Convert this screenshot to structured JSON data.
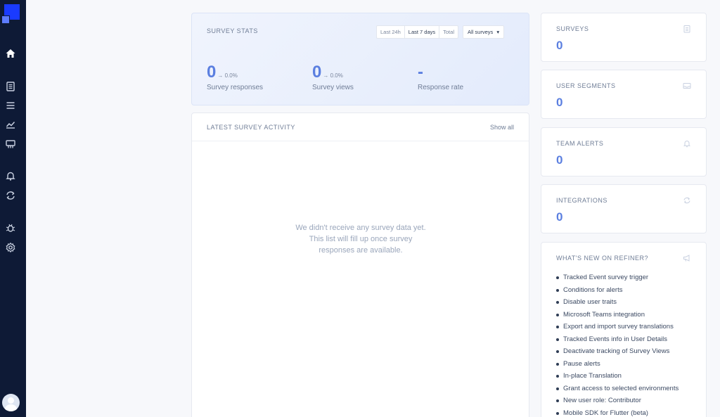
{
  "sidebar": {
    "items": [
      {
        "name": "home-icon"
      },
      {
        "name": "surveys-icon"
      },
      {
        "name": "list-icon"
      },
      {
        "name": "chart-icon"
      },
      {
        "name": "segments-icon"
      },
      {
        "name": "bell-icon"
      },
      {
        "name": "sync-icon"
      },
      {
        "name": "bug-icon"
      },
      {
        "name": "gear-icon"
      }
    ]
  },
  "stats": {
    "title": "SURVEY STATS",
    "filters": [
      "Last 24h",
      "Last 7 days",
      "Total"
    ],
    "active_filter": "Last 7 days",
    "select": "All surveys",
    "responses": {
      "value": "0",
      "change": "→ 0.0%",
      "label": "Survey responses"
    },
    "views": {
      "value": "0",
      "change": "→ 0.0%",
      "label": "Survey views"
    },
    "rate": {
      "value": "-",
      "label": "Response rate"
    }
  },
  "activity": {
    "title": "LATEST SURVEY ACTIVITY",
    "show_all": "Show all",
    "empty_message": "We didn't receive any survey data yet. This list will fill up once survey responses are available."
  },
  "side_cards": {
    "surveys": {
      "title": "SURVEYS",
      "value": "0",
      "icon": "clipboard-icon"
    },
    "segments": {
      "title": "USER SEGMENTS",
      "value": "0",
      "icon": "inbox-icon"
    },
    "alerts": {
      "title": "TEAM ALERTS",
      "value": "0",
      "icon": "bell-icon"
    },
    "integrations": {
      "title": "INTEGRATIONS",
      "value": "0",
      "icon": "sync-icon"
    }
  },
  "news": {
    "title": "WHAT'S NEW ON REFINER?",
    "icon": "megaphone-icon",
    "items": [
      "Tracked Event survey trigger",
      "Conditions for alerts",
      "Disable user traits",
      "Microsoft Teams integration",
      "Export and import survey translations",
      "Tracked Events info in User Details",
      "Deactivate tracking of Survey Views",
      "Pause alerts",
      "In-place Translation",
      "Grant access to selected environments",
      "New user role: Contributor",
      "Mobile SDK for Flutter (beta)"
    ]
  },
  "colors": {
    "sidebar": "#0e1a36",
    "accent": "#5b7fe0",
    "logo": "#1a3bff"
  }
}
